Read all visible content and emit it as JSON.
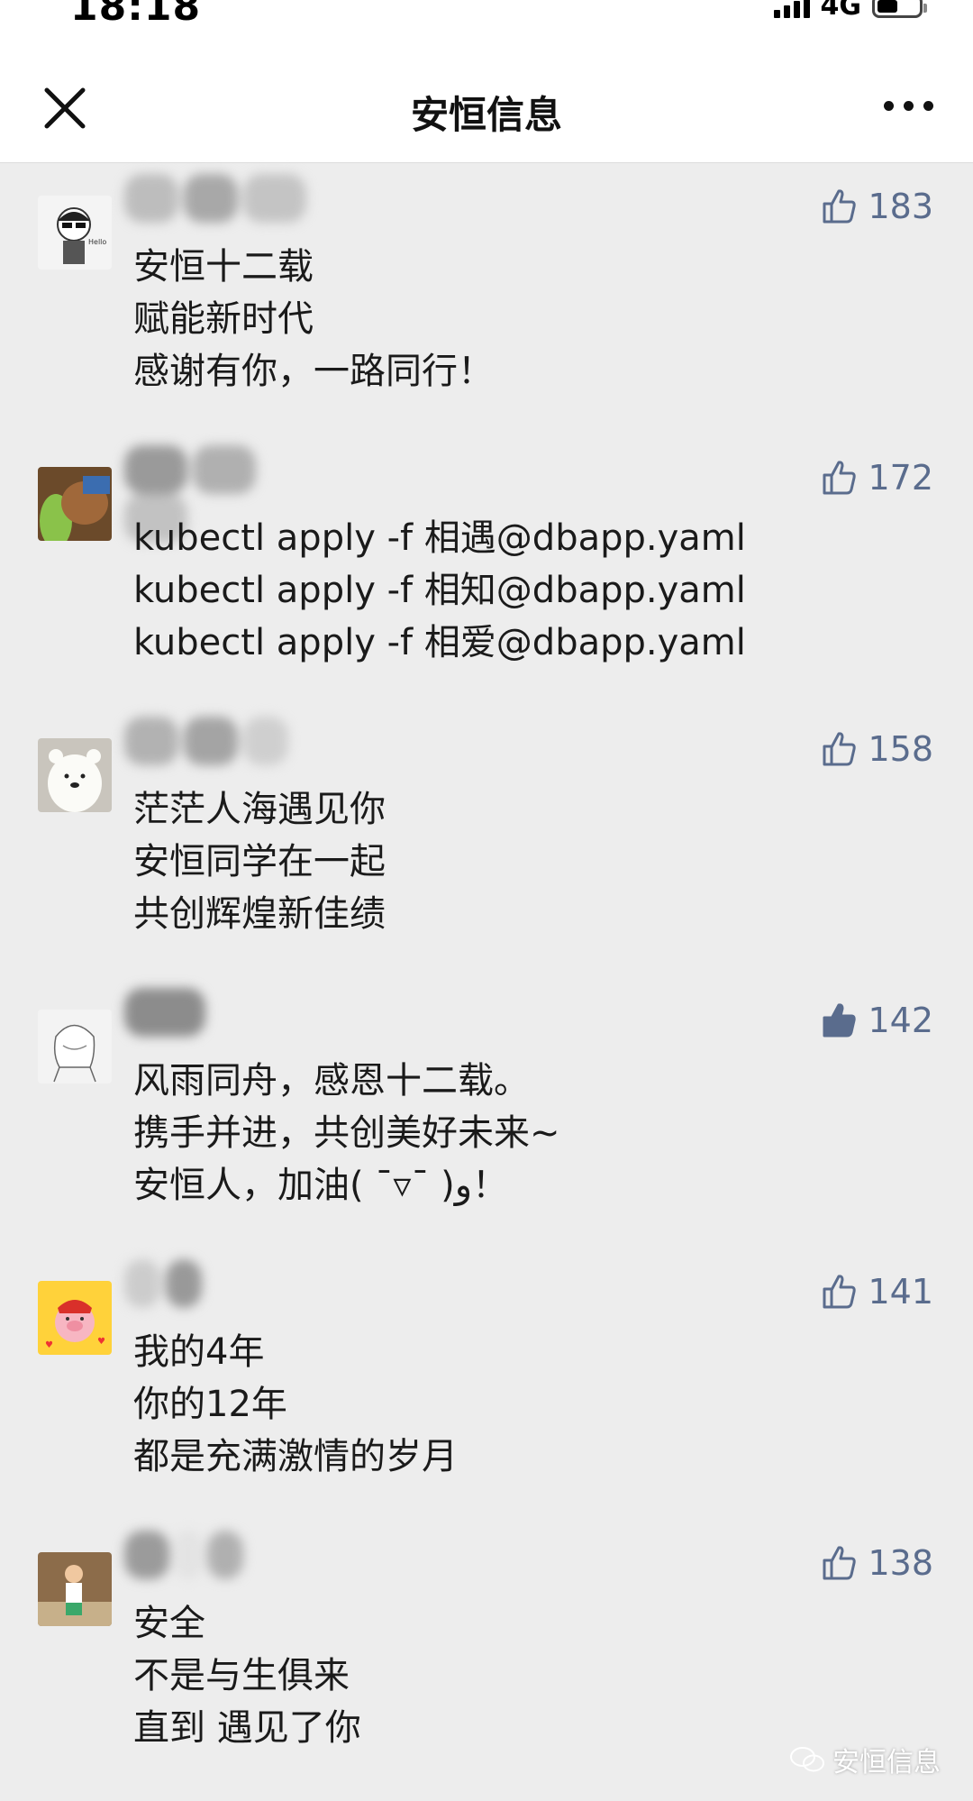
{
  "status": {
    "time": "18:18",
    "network": "4G"
  },
  "header": {
    "title": "安恒信息"
  },
  "comments": [
    {
      "likes": "183",
      "liked": false,
      "lines": [
        "安恒十二载",
        "赋能新时代",
        "感谢有你，一路同行！"
      ]
    },
    {
      "likes": "172",
      "liked": false,
      "lines": [
        "kubectl apply -f 相遇@dbapp.yaml",
        "kubectl apply -f 相知@dbapp.yaml",
        "kubectl apply -f 相爱@dbapp.yaml"
      ]
    },
    {
      "likes": "158",
      "liked": false,
      "lines": [
        "茫茫人海遇见你",
        "安恒同学在一起",
        "共创辉煌新佳绩"
      ]
    },
    {
      "likes": "142",
      "liked": true,
      "lines": [
        "风雨同舟，感恩十二载。",
        "携手并进，共创美好未来~",
        "安恒人，加油( ˉ▿ˉ )و！"
      ]
    },
    {
      "likes": "141",
      "liked": false,
      "lines": [
        "我的4年",
        "你的12年",
        "都是充满激情的岁月"
      ]
    },
    {
      "likes": "138",
      "liked": false,
      "lines": [
        "安全",
        "不是与生俱来",
        "直到 遇见了你"
      ]
    }
  ],
  "watermark": {
    "text": "安恒信息"
  },
  "colors": {
    "like": "#5a6c8d",
    "background": "#ededed"
  }
}
